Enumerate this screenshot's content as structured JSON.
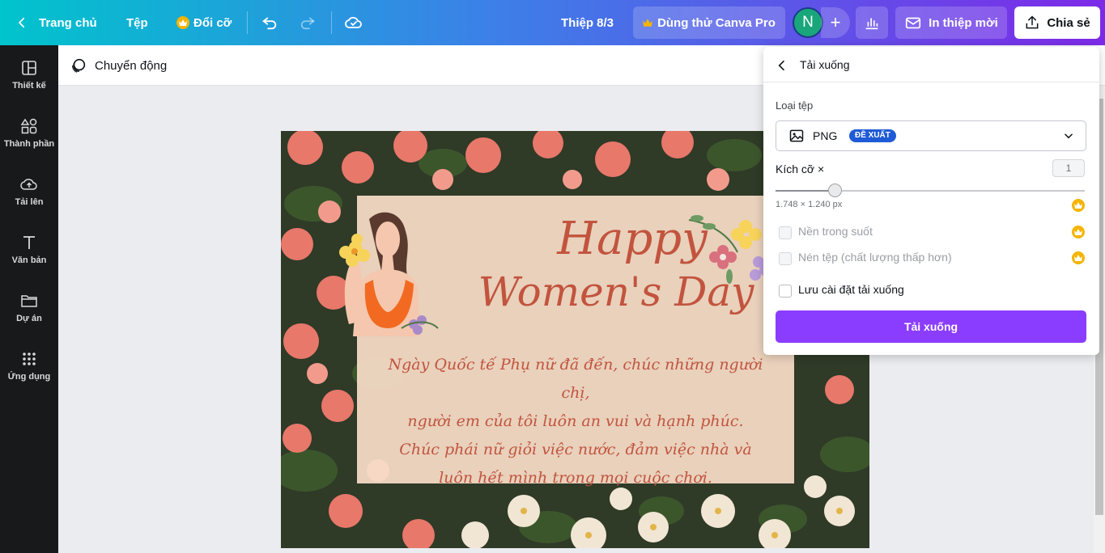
{
  "topbar": {
    "home_label": "Trang chủ",
    "file_label": "Tệp",
    "resize_label": "Đổi cỡ",
    "doc_title": "Thiệp 8/3",
    "pro_label": "Dùng thử Canva Pro",
    "avatar_initial": "N",
    "print_label": "In thiệp mời",
    "share_label": "Chia sẻ"
  },
  "sidebar": {
    "items": [
      {
        "label": "Thiết kế",
        "icon": "layout-icon"
      },
      {
        "label": "Thành phần",
        "icon": "shapes-icon"
      },
      {
        "label": "Tải lên",
        "icon": "upload-cloud-icon"
      },
      {
        "label": "Văn bản",
        "icon": "text-icon"
      },
      {
        "label": "Dự án",
        "icon": "folder-icon"
      },
      {
        "label": "Ứng dụng",
        "icon": "apps-grid-icon"
      }
    ]
  },
  "toolbar": {
    "animate_label": "Chuyển động"
  },
  "design": {
    "title_line1": "Happy",
    "title_line2": "Women's Day",
    "wish_line1": "Ngày Quốc tế Phụ nữ đã đến, chúc những người chị,",
    "wish_line2": "người em của tôi luôn an vui và hạnh phúc.",
    "wish_line3": "Chúc phái nữ giỏi việc nước, đảm việc nhà và",
    "wish_line4": "luôn hết mình trong mọi cuộc chơi."
  },
  "download_panel": {
    "title": "Tải xuống",
    "file_type_label": "Loại tệp",
    "file_type_value": "PNG",
    "recommended_badge": "ĐỀ XUẤT",
    "size_label": "Kích cỡ ×",
    "size_value": "1",
    "size_slider_fraction": 0.19,
    "dimensions_text": "1.748 × 1.240 px",
    "transparent_bg_label": "Nền trong suốt",
    "compress_label": "Nén tệp (chất lượng thấp hơn)",
    "save_settings_label": "Lưu cài đặt tải xuống",
    "download_button_label": "Tải xuống"
  },
  "colors": {
    "accent_purple": "#8b3dff",
    "badge_blue": "#1f5bd6",
    "crown_gold": "#f5b400",
    "title_rose": "#c2543e"
  }
}
